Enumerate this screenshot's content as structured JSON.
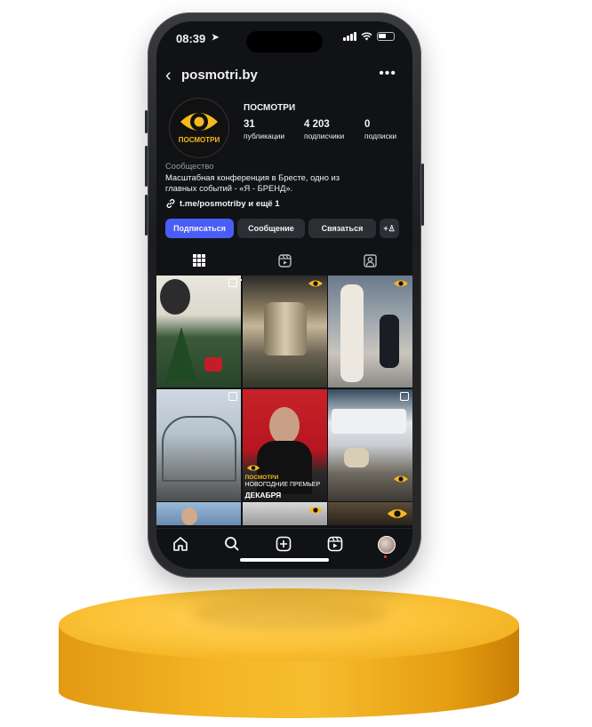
{
  "status_bar": {
    "time": "08:39"
  },
  "header": {
    "username": "posmotri.by"
  },
  "profile": {
    "avatar_label": "ПОСМОТРИ",
    "display_name": "ПОСМОТРИ",
    "stats": [
      {
        "value": "31",
        "label": "публикации"
      },
      {
        "value": "4 203",
        "label": "подписчики"
      },
      {
        "value": "0",
        "label": "подписки"
      }
    ],
    "category": "Сообщество",
    "bio_line1": "Масштабная конференция в Бресте, одно из",
    "bio_line2": "главных событий - «Я - БРЕНД».",
    "link": "t.me/posmotriby и ещё 1"
  },
  "actions": {
    "follow": "Подписаться",
    "message": "Сообщение",
    "contact": "Связаться"
  },
  "posts": {
    "badge_text": "ПОСМОТРИ",
    "post5_line1": "НОВОГОДНИЕ ПРЕМЬЕР",
    "post5_line2": "ДЕКАБРЯ"
  },
  "colors": {
    "accent": "#4a5df9",
    "brand_yellow": "#f7b820",
    "podium": "#f4b625"
  }
}
